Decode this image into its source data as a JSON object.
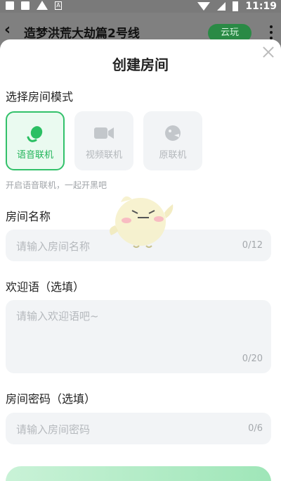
{
  "status_bar": {
    "time": "11:19"
  },
  "header": {
    "back_icon": "chevron-left-icon",
    "title": "造梦洪荒大劫篇2号线",
    "cloud_button": "云玩",
    "more_icon": "more-vertical-icon"
  },
  "dialog": {
    "title": "创建房间",
    "close_icon": "close-icon",
    "mode_section": {
      "label": "选择房间模式",
      "options": [
        {
          "label": "语音联机",
          "icon": "microphone-icon",
          "selected": true
        },
        {
          "label": "视频联机",
          "icon": "video-camera-icon",
          "selected": false
        },
        {
          "label": "原联机",
          "icon": "gamepad-icon",
          "selected": false
        }
      ],
      "hint": "开启语音联机，一起开黑吧"
    },
    "room_name": {
      "label": "房间名称",
      "placeholder": "请输入房间名称",
      "count": "0/12"
    },
    "welcome": {
      "label": "欢迎语（选填）",
      "placeholder": "请输入欢迎语吧~",
      "count": "0/20"
    },
    "password": {
      "label": "房间密码（选填）",
      "placeholder": "请输入房间密码",
      "count": "0/6"
    }
  },
  "colors": {
    "accent": "#32c16a",
    "field_bg": "#f2f4f6",
    "header_button": "#2a8a45"
  }
}
